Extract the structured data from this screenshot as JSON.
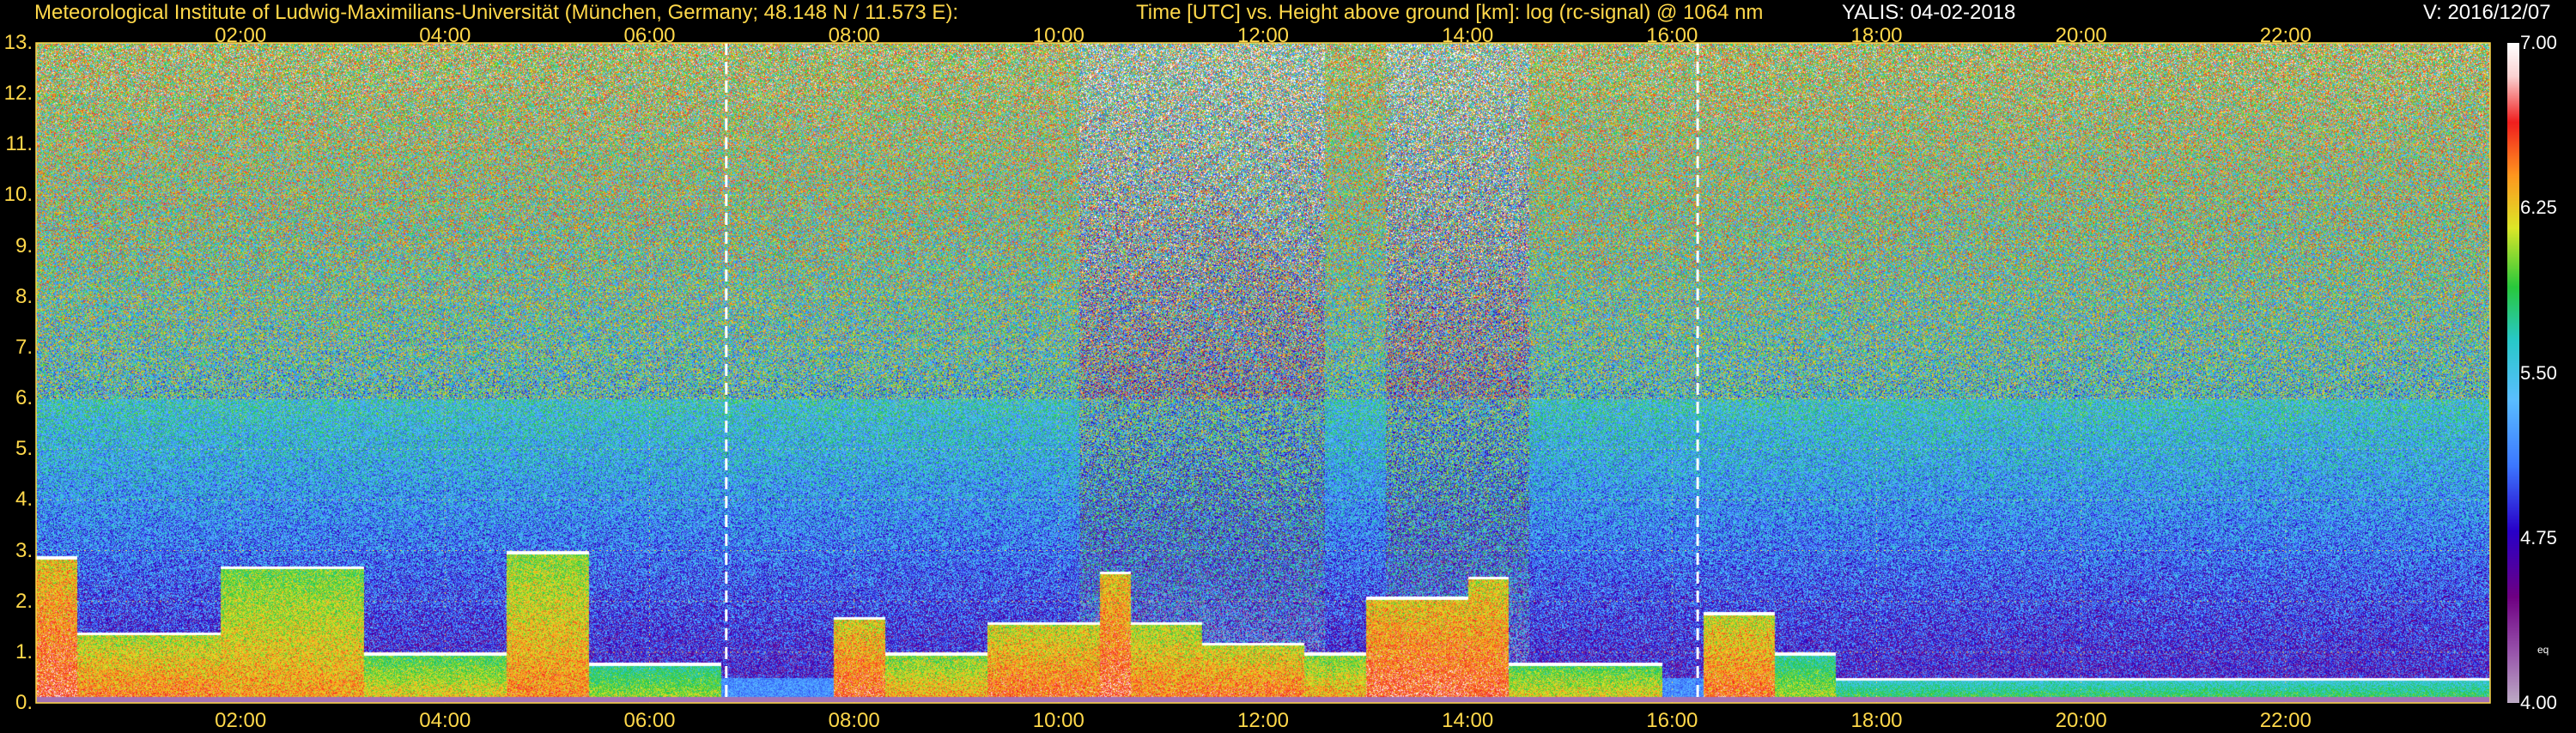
{
  "header": {
    "institute": "Meteorological Institute of Ludwig-Maximilians-Universität (München, Germany; 48.148 N / 11.573 E):",
    "description": "Time [UTC] vs. Height above ground [km]: log (rc-signal) @ 1064 nm",
    "instrument_date": "YALIS: 04-02-2018",
    "version": "V: 2016/12/07"
  },
  "chart_data": {
    "type": "heatmap",
    "title": "Time [UTC] vs. Height above ground [km]: log (rc-signal) @ 1064 nm",
    "x_ticks": [
      "02:00",
      "04:00",
      "06:00",
      "08:00",
      "10:00",
      "12:00",
      "14:00",
      "16:00",
      "18:00",
      "20:00",
      "22:00"
    ],
    "x_tick_hours": [
      2,
      4,
      6,
      8,
      10,
      12,
      14,
      16,
      18,
      20,
      22
    ],
    "x_range_hours": [
      0,
      24
    ],
    "y_ticks": [
      "13.",
      "12.",
      "11.",
      "10.",
      "9.",
      "8.",
      "7.",
      "6.",
      "5.",
      "4.",
      "3.",
      "2.",
      "1.",
      "0."
    ],
    "y_tick_km": [
      13,
      12,
      11,
      10,
      9,
      8,
      7,
      6,
      5,
      4,
      3,
      2,
      1,
      0
    ],
    "y_range_km": [
      0,
      13
    ],
    "dashed_markers_hours": [
      6.75,
      16.25
    ],
    "colorbar": {
      "labels": [
        "7.00",
        "6.25",
        "5.50",
        "4.75",
        "4.00"
      ],
      "label_values": [
        7.0,
        6.25,
        5.5,
        4.75,
        4.0
      ],
      "range": [
        4.0,
        7.0
      ],
      "extra_label": "eq"
    },
    "aerosol_layers": [
      {
        "start_h": 0.0,
        "end_h": 0.4,
        "top_km": 2.9,
        "intensity": 0.95
      },
      {
        "start_h": 0.4,
        "end_h": 1.8,
        "top_km": 1.4,
        "intensity": 0.8
      },
      {
        "start_h": 1.7,
        "end_h": 3.2,
        "top_km": 2.7,
        "intensity": 0.7
      },
      {
        "start_h": 3.2,
        "end_h": 4.6,
        "top_km": 1.0,
        "intensity": 0.6
      },
      {
        "start_h": 4.6,
        "end_h": 5.4,
        "top_km": 3.0,
        "intensity": 0.75
      },
      {
        "start_h": 5.4,
        "end_h": 6.7,
        "top_km": 0.8,
        "intensity": 0.45
      },
      {
        "start_h": 7.8,
        "end_h": 8.3,
        "top_km": 1.7,
        "intensity": 0.9
      },
      {
        "start_h": 8.3,
        "end_h": 9.3,
        "top_km": 1.0,
        "intensity": 0.7
      },
      {
        "start_h": 9.3,
        "end_h": 10.4,
        "top_km": 1.6,
        "intensity": 0.85
      },
      {
        "start_h": 10.4,
        "end_h": 10.7,
        "top_km": 2.6,
        "intensity": 0.95
      },
      {
        "start_h": 10.7,
        "end_h": 11.4,
        "top_km": 1.6,
        "intensity": 0.8
      },
      {
        "start_h": 11.4,
        "end_h": 12.4,
        "top_km": 1.2,
        "intensity": 0.85
      },
      {
        "start_h": 12.4,
        "end_h": 13.0,
        "top_km": 1.0,
        "intensity": 0.7
      },
      {
        "start_h": 13.0,
        "end_h": 14.0,
        "top_km": 2.1,
        "intensity": 0.95
      },
      {
        "start_h": 14.0,
        "end_h": 14.4,
        "top_km": 2.5,
        "intensity": 0.9
      },
      {
        "start_h": 14.4,
        "end_h": 15.9,
        "top_km": 0.8,
        "intensity": 0.6
      },
      {
        "start_h": 16.3,
        "end_h": 17.0,
        "top_km": 1.8,
        "intensity": 0.85
      },
      {
        "start_h": 17.0,
        "end_h": 17.6,
        "top_km": 1.0,
        "intensity": 0.45
      },
      {
        "start_h": 17.6,
        "end_h": 24.0,
        "top_km": 0.5,
        "intensity": 0.3
      }
    ]
  }
}
